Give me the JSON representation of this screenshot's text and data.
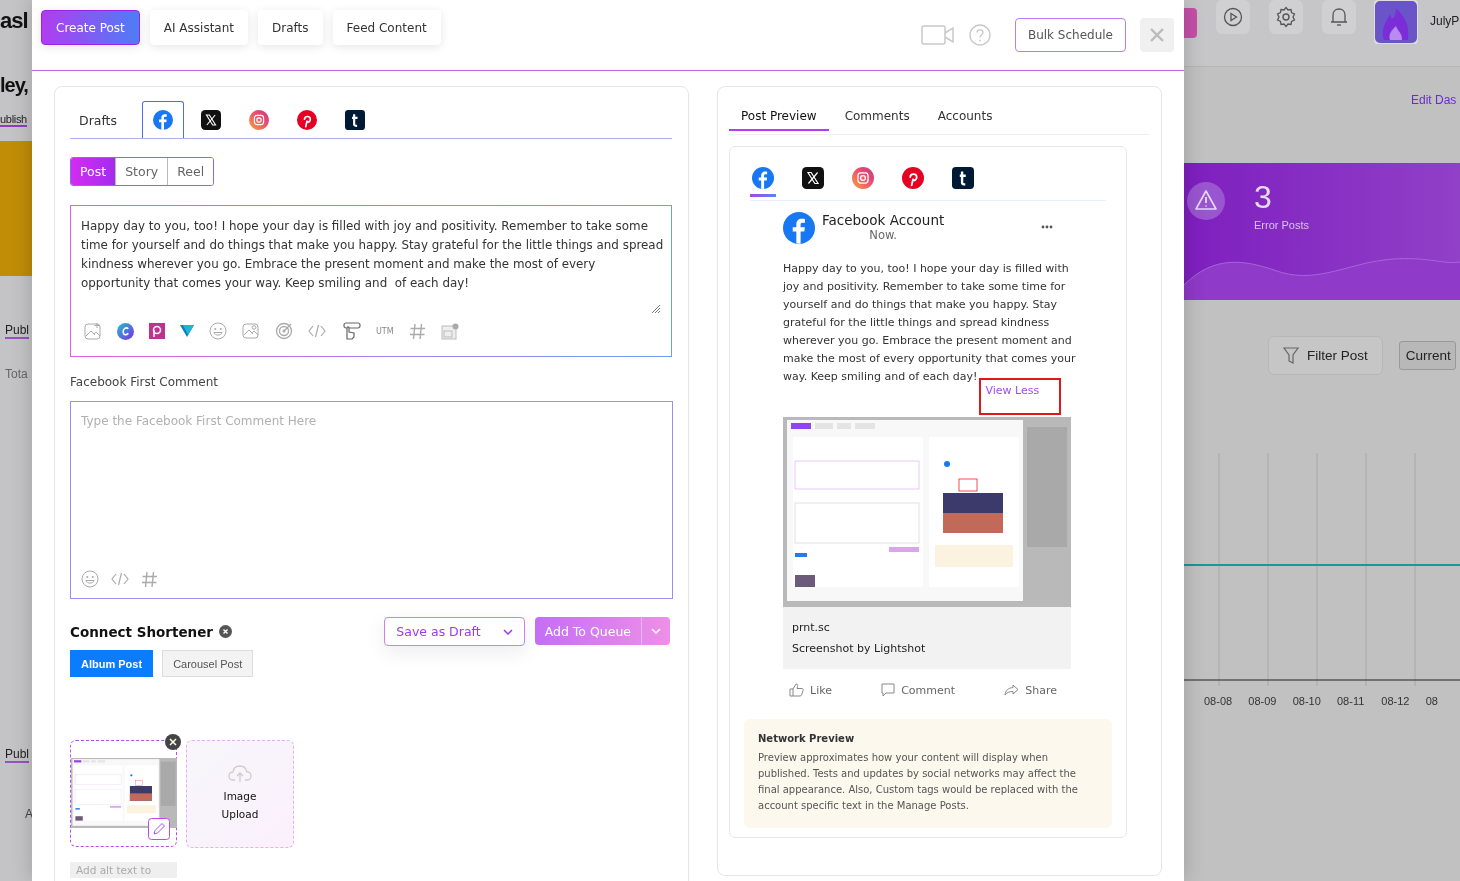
{
  "background": {
    "page_title": "asl",
    "greeting": "ley,",
    "tab": "ublish",
    "section_1": "Publ",
    "total_label": "Tota",
    "section_2": "Publ",
    "footer_text": "A",
    "user_name": "JulyP",
    "edit_link": "Edit Das",
    "error_card": {
      "count": "3",
      "label": "Error Posts"
    },
    "filter_button": "Filter Post",
    "period_select": "Current",
    "chart_x_labels": [
      "08-08",
      "08-09",
      "08-10",
      "08-11",
      "08-12",
      "08"
    ]
  },
  "modal": {
    "tabs": [
      {
        "label": "Create Post",
        "selected": true
      },
      {
        "label": "AI Assistant",
        "selected": false
      },
      {
        "label": "Drafts",
        "selected": false
      },
      {
        "label": "Feed Content",
        "selected": false
      }
    ],
    "bulk_schedule": "Bulk Schedule",
    "composer": {
      "channel_tabs": [
        {
          "kind": "text",
          "label": "Drafts",
          "selected": false
        },
        {
          "kind": "facebook",
          "selected": true
        },
        {
          "kind": "x",
          "selected": false
        },
        {
          "kind": "instagram",
          "selected": false
        },
        {
          "kind": "pinterest",
          "selected": false
        },
        {
          "kind": "tumblr",
          "selected": false
        }
      ],
      "post_types": [
        {
          "label": "Post",
          "selected": true
        },
        {
          "label": "Story",
          "selected": false
        },
        {
          "label": "Reel",
          "selected": false
        }
      ],
      "content": "Happy day to you, too! I hope your day is filled with joy and positivity. Remember to take some time for yourself and do things that make you happy. Stay grateful for the little things and spread kindness wherever you go. Embrace the present moment and make the most of every opportunity that comes your way. Keep smiling and  of each day!",
      "utm_label": "UTM",
      "first_comment_label": "Facebook First Comment",
      "first_comment_placeholder": "Type the Facebook First Comment Here",
      "shortener_label": "Connect Shortener",
      "save_draft": "Save as Draft",
      "add_queue": "Add To Queue",
      "layout_options": [
        {
          "label": "Album Post",
          "selected": true
        },
        {
          "label": "Carousel Post",
          "selected": false
        }
      ],
      "upload_label": "Image Upload",
      "alt_text_placeholder": "Add alt text to"
    },
    "preview": {
      "tabs": [
        {
          "label": "Post Preview",
          "selected": true
        },
        {
          "label": "Comments",
          "selected": false
        },
        {
          "label": "Accounts",
          "selected": false
        }
      ],
      "networks": [
        {
          "kind": "facebook",
          "selected": true
        },
        {
          "kind": "x",
          "selected": false
        },
        {
          "kind": "instagram",
          "selected": false
        },
        {
          "kind": "pinterest",
          "selected": false
        },
        {
          "kind": "tumblr",
          "selected": false
        }
      ],
      "account_name": "Facebook Account",
      "time": "Now.",
      "text": "Happy day to you, too! I hope your day is filled with joy and positivity. Remember to take some time for yourself and do things that make you happy. Stay grateful for the little things and spread kindness wherever you go. Embrace the present moment and make the most of every opportunity that comes your way. Keep smiling and of each day!",
      "view_less": "View Less",
      "link_domain": "prnt.sc",
      "link_title": "Screenshot by Lightshot",
      "actions": [
        {
          "kind": "like",
          "label": "Like"
        },
        {
          "kind": "comment",
          "label": "Comment"
        },
        {
          "kind": "share",
          "label": "Share"
        }
      ],
      "notice": {
        "title": "Network Preview",
        "body": "Preview approximates how your content will display when published. Tests and updates by social networks may affect the final appearance. Also, Custom tags would be replaced with the account specific text in the Manage Posts."
      }
    }
  }
}
